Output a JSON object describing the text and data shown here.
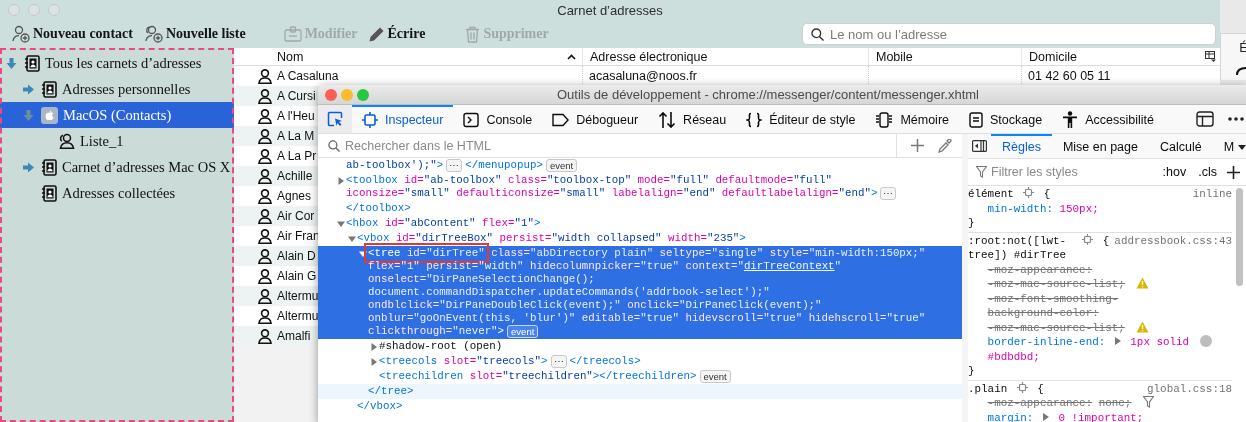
{
  "window": {
    "title": "Carnet d’adresses"
  },
  "toolbar": {
    "buttons": [
      {
        "label": "Nouveau contact",
        "kind": "new-contact",
        "disabled": false
      },
      {
        "label": "Nouvelle liste",
        "kind": "new-list",
        "disabled": false
      },
      {
        "label": "Modifier",
        "kind": "edit",
        "disabled": true
      },
      {
        "label": "Écrire",
        "kind": "write",
        "disabled": false
      },
      {
        "label": "Supprimer",
        "kind": "delete",
        "disabled": true
      }
    ],
    "search": {
      "placeholder": "Le nom ou l’adresse"
    }
  },
  "sidebar": {
    "items": [
      {
        "label": "Tous les carnets d’adresses",
        "kind": "book",
        "expanded": true,
        "selected": false,
        "children": [
          {
            "label": "Adresses personnelles",
            "kind": "book",
            "expanded": false,
            "selected": false
          },
          {
            "label": "MacOS (Contacts)",
            "kind": "mac",
            "expanded": true,
            "selected": true,
            "children": [
              {
                "label": "Liste_1",
                "kind": "list",
                "selected": false
              }
            ]
          },
          {
            "label": "Carnet d’adresses Mac OS X",
            "kind": "book",
            "expanded": false,
            "selected": false
          },
          {
            "label": "Adresses collectées",
            "kind": "book",
            "selected": false
          }
        ]
      }
    ]
  },
  "contacts": {
    "columns": [
      {
        "label": "Nom",
        "sorted": true
      },
      {
        "label": "Adresse électronique",
        "sorted": false
      },
      {
        "label": "Mobile",
        "sorted": false
      },
      {
        "label": "Domicile",
        "sorted": false
      }
    ],
    "rows": [
      {
        "name": "A Casaluna",
        "email": "acasaluna@noos.fr",
        "home": "01 42 60 05 11"
      },
      {
        "name": "A Cursi"
      },
      {
        "name": "A l'Heu"
      },
      {
        "name": "A La M"
      },
      {
        "name": "A La Pr"
      },
      {
        "name": "Achille"
      },
      {
        "name": "Agnes"
      },
      {
        "name": "Air Cor"
      },
      {
        "name": "Air Fran"
      },
      {
        "name": "Alain D"
      },
      {
        "name": "Alain G"
      },
      {
        "name": "Altermu"
      },
      {
        "name": "Altermu"
      },
      {
        "name": "Amalfi"
      }
    ]
  },
  "background_window": {
    "text": "É"
  },
  "devtools": {
    "title": "Outils de développement - chrome://messenger/content/messenger.xhtml",
    "tabs": [
      {
        "label": "Inspecteur",
        "kind": "inspector",
        "selected": true
      },
      {
        "label": "Console",
        "kind": "console",
        "selected": false
      },
      {
        "label": "Débogueur",
        "kind": "debugger",
        "selected": false
      },
      {
        "label": "Réseau",
        "kind": "network",
        "selected": false
      },
      {
        "label": "Éditeur de style",
        "kind": "style",
        "selected": false
      },
      {
        "label": "Mémoire",
        "kind": "memory",
        "selected": false
      },
      {
        "label": "Stockage",
        "kind": "storage",
        "selected": false
      },
      {
        "label": "Accessibilité",
        "kind": "accessibility",
        "selected": false
      }
    ],
    "markup": {
      "search": {
        "placeholder": "Rechercher dans le HTML"
      },
      "nodes": [
        {
          "selected": false,
          "lines": [
            [
              {
                "kind": "val",
                "text": "ab-toolbox');\""
              },
              {
                "kind": "tag",
                "text": ">"
              },
              {
                "kind": "more",
                "text": "⋯"
              },
              {
                "kind": "tag",
                "text": "</menupopup>"
              },
              {
                "kind": "event",
                "text": "event"
              }
            ]
          ]
        },
        {
          "selected": false,
          "expanded": false,
          "lines": [
            [
              {
                "kind": "tag",
                "text": "<toolbox"
              },
              {
                "kind": "attr",
                "text": " id="
              },
              {
                "kind": "val",
                "text": "\"ab-toolbox\""
              },
              {
                "kind": "attr",
                "text": " class="
              },
              {
                "kind": "val",
                "text": "\"toolbox-top\""
              },
              {
                "kind": "attr",
                "text": " mode="
              },
              {
                "kind": "val",
                "text": "\"full\""
              },
              {
                "kind": "attr",
                "text": " defaultmode="
              },
              {
                "kind": "val",
                "text": "\"full\""
              }
            ],
            [
              {
                "kind": "attr",
                "text": "iconsize="
              },
              {
                "kind": "val",
                "text": "\"small\""
              },
              {
                "kind": "attr",
                "text": " defaulticonsize="
              },
              {
                "kind": "val",
                "text": "\"small\""
              },
              {
                "kind": "attr",
                "text": " labelalign="
              },
              {
                "kind": "val",
                "text": "\"end\""
              },
              {
                "kind": "attr",
                "text": " defaultlabelalign="
              },
              {
                "kind": "val",
                "text": "\"end\""
              },
              {
                "kind": "tag",
                "text": ">"
              },
              {
                "kind": "more",
                "text": "⋯"
              }
            ]
          ],
          "close": [
            {
              "kind": "tag",
              "text": "</toolbox>"
            }
          ],
          "close_hovered": false
        },
        {
          "selected": false,
          "expanded": true,
          "lines": [
            [
              {
                "kind": "tag",
                "text": "<hbox"
              },
              {
                "kind": "attr",
                "text": " id="
              },
              {
                "kind": "val",
                "text": "\"abContent\""
              },
              {
                "kind": "attr",
                "text": " flex="
              },
              {
                "kind": "val",
                "text": "\"1\""
              },
              {
                "kind": "tag",
                "text": ">"
              }
            ]
          ],
          "children": [
            {
              "selected": false,
              "expanded": true,
              "lines": [
                [
                  {
                    "kind": "tag",
                    "text": "<vbox"
                  },
                  {
                    "kind": "attr",
                    "text": " id="
                  },
                  {
                    "kind": "val",
                    "text": "\"dirTreeBox\""
                  },
                  {
                    "kind": "attr",
                    "text": " persist="
                  },
                  {
                    "kind": "val",
                    "text": "\"width collapsed\""
                  },
                  {
                    "kind": "attr",
                    "text": " width="
                  },
                  {
                    "kind": "val",
                    "text": "\"235\""
                  },
                  {
                    "kind": "tag",
                    "text": ">"
                  }
                ]
              ],
              "children": [
                {
                  "selected": true,
                  "expanded": true,
                  "lines": [
                    [
                      {
                        "kind": "box",
                        "tokens": [
                          {
                            "kind": "tag",
                            "text": "<tree"
                          },
                          {
                            "kind": "attr",
                            "text": " id="
                          },
                          {
                            "kind": "val",
                            "text": "\"dirTree\""
                          }
                        ]
                      },
                      {
                        "kind": "attr",
                        "text": " class="
                      },
                      {
                        "kind": "val",
                        "text": "\"abDirectory plain\""
                      },
                      {
                        "kind": "attr",
                        "text": " seltype="
                      },
                      {
                        "kind": "val",
                        "text": "\"single\""
                      },
                      {
                        "kind": "attr",
                        "text": " style="
                      },
                      {
                        "kind": "val",
                        "text": "\"min-width:150px;\""
                      }
                    ],
                    [
                      {
                        "kind": "attr",
                        "text": "flex="
                      },
                      {
                        "kind": "val",
                        "text": "\"1\""
                      },
                      {
                        "kind": "attr",
                        "text": " persist="
                      },
                      {
                        "kind": "val",
                        "text": "\"width\""
                      },
                      {
                        "kind": "attr",
                        "text": " hidecolumnpicker="
                      },
                      {
                        "kind": "val",
                        "text": "\"true\""
                      },
                      {
                        "kind": "attr",
                        "text": " context="
                      },
                      {
                        "kind": "val",
                        "text": "\""
                      },
                      {
                        "kind": "link",
                        "text": "dirTreeContext"
                      },
                      {
                        "kind": "val",
                        "text": "\""
                      }
                    ],
                    [
                      {
                        "kind": "attr",
                        "text": "onselect="
                      },
                      {
                        "kind": "val",
                        "text": "\"DirPaneSelectionChange();"
                      }
                    ],
                    [
                      {
                        "kind": "val",
                        "text": "document.commandDispatcher.updateCommands('addrbook-select');\""
                      }
                    ],
                    [
                      {
                        "kind": "attr",
                        "text": "ondblclick="
                      },
                      {
                        "kind": "val",
                        "text": "\"DirPaneDoubleClick(event);\""
                      },
                      {
                        "kind": "attr",
                        "text": " onclick="
                      },
                      {
                        "kind": "val",
                        "text": "\"DirPaneClick(event);\""
                      }
                    ],
                    [
                      {
                        "kind": "attr",
                        "text": "onblur="
                      },
                      {
                        "kind": "val",
                        "text": "\"goOnEvent(this, 'blur')\""
                      },
                      {
                        "kind": "attr",
                        "text": " editable="
                      },
                      {
                        "kind": "val",
                        "text": "\"true\""
                      },
                      {
                        "kind": "attr",
                        "text": " hidevscroll="
                      },
                      {
                        "kind": "val",
                        "text": "\"true\""
                      },
                      {
                        "kind": "attr",
                        "text": " hidehscroll="
                      },
                      {
                        "kind": "val",
                        "text": "\"true\""
                      }
                    ],
                    [
                      {
                        "kind": "attr",
                        "text": "clickthrough="
                      },
                      {
                        "kind": "val",
                        "text": "\"never\""
                      },
                      {
                        "kind": "tag",
                        "text": ">"
                      },
                      {
                        "kind": "event",
                        "text": "event"
                      }
                    ]
                  ],
                  "children": [
                    {
                      "selected": false,
                      "expanded": false,
                      "lines": [
                        [
                          {
                            "kind": "text",
                            "text": "#shadow-root (open)"
                          }
                        ]
                      ]
                    },
                    {
                      "selected": false,
                      "expanded": false,
                      "lines": [
                        [
                          {
                            "kind": "tag",
                            "text": "<treecols"
                          },
                          {
                            "kind": "attr",
                            "text": " slot="
                          },
                          {
                            "kind": "val",
                            "text": "\"treecols\""
                          },
                          {
                            "kind": "tag",
                            "text": ">"
                          },
                          {
                            "kind": "more",
                            "text": "⋯"
                          },
                          {
                            "kind": "tag",
                            "text": "</treecols>"
                          }
                        ]
                      ]
                    },
                    {
                      "selected": false,
                      "lines": [
                        [
                          {
                            "kind": "tag",
                            "text": "<treechildren"
                          },
                          {
                            "kind": "attr",
                            "text": " slot="
                          },
                          {
                            "kind": "val",
                            "text": "\"treechildren\""
                          },
                          {
                            "kind": "tag",
                            "text": "></treechildren>"
                          },
                          {
                            "kind": "event",
                            "text": "event"
                          }
                        ]
                      ]
                    }
                  ],
                  "close": [
                    {
                      "kind": "tag",
                      "text": "</tree>"
                    }
                  ],
                  "close_hovered": true
                }
              ],
              "close": [
                {
                  "kind": "tag",
                  "text": "</vbox>"
                }
              ],
              "close_hovered": false
            }
          ]
        }
      ]
    },
    "rules": {
      "tabs": [
        {
          "label": "Règles",
          "selected": true,
          "menu": false
        },
        {
          "label": "Mise en page",
          "selected": false,
          "menu": false
        },
        {
          "label": "Calculé",
          "selected": false,
          "menu": false
        },
        {
          "label": "M",
          "selected": false,
          "menu": true
        }
      ],
      "filter": {
        "placeholder": "Filtrer les styles"
      },
      "buttons": [
        ":hov",
        ".cls"
      ],
      "rules": [
        {
          "selector": "élément",
          "source": "inline",
          "open": "{",
          "close": "}",
          "decls": [
            {
              "prop": "min-width:",
              "value": "150px;",
              "overridden": false,
              "expandable": false
            }
          ]
        },
        {
          "selector": ":root:not([lwt-tree]) #dirTree",
          "source": "addressbook.css:43",
          "open": "{",
          "close": "}",
          "decls": [
            {
              "prop": "-moz-appearance:",
              "value": "-moz-mac-source-list;",
              "overridden": true,
              "expandable": false,
              "warning": true
            },
            {
              "prop": "-moz-font-smoothing-background-color:",
              "value": "-moz-mac-source-list;",
              "overridden": true,
              "expandable": false,
              "warning": true
            },
            {
              "prop": "border-inline-end:",
              "value": "1px solid",
              "overridden": false,
              "expandable": true,
              "color": "#bdbdbd",
              "value_end": "#bdbdbd;"
            }
          ]
        },
        {
          "selector": ".plain",
          "source": "global.css:18",
          "open": "{",
          "decls": [
            {
              "prop": "-moz-appearance:",
              "value": "none;",
              "overridden": true,
              "expandable": false,
              "filter_button": true
            },
            {
              "prop": "margin:",
              "value": "0 !important;",
              "overridden": false,
              "expandable": true
            }
          ]
        }
      ]
    }
  }
}
